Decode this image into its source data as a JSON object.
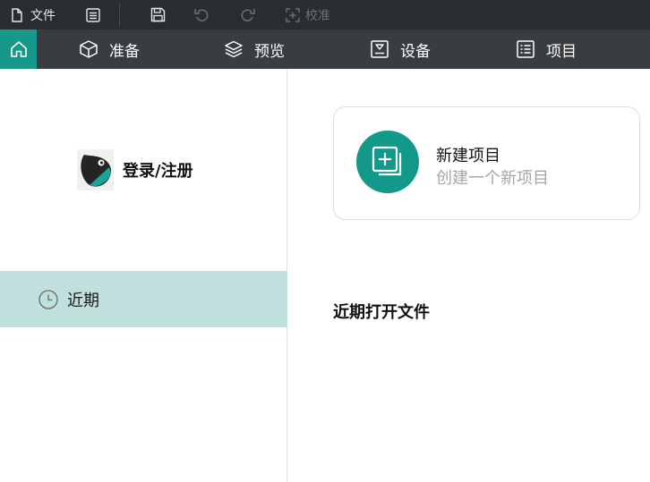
{
  "toolbar": {
    "file_label": "文件",
    "calibrate_label": "校准"
  },
  "nav": {
    "tabs": [
      {
        "label": "准备",
        "icon": "cube-icon"
      },
      {
        "label": "预览",
        "icon": "layers-icon"
      },
      {
        "label": "设备",
        "icon": "device-icon"
      },
      {
        "label": "项目",
        "icon": "list-icon"
      }
    ],
    "home_icon": "home-icon"
  },
  "sidebar": {
    "login_label": "登录/注册",
    "recent_label": "近期"
  },
  "main": {
    "new_project_title": "新建项目",
    "new_project_subtitle": "创建一个新项目",
    "recent_files_heading": "近期打开文件"
  },
  "colors": {
    "accent": "#16998a",
    "toolbar_bg": "#2a2d2f",
    "navbar_bg": "#393d40",
    "selected_bg": "#c0e0de"
  }
}
